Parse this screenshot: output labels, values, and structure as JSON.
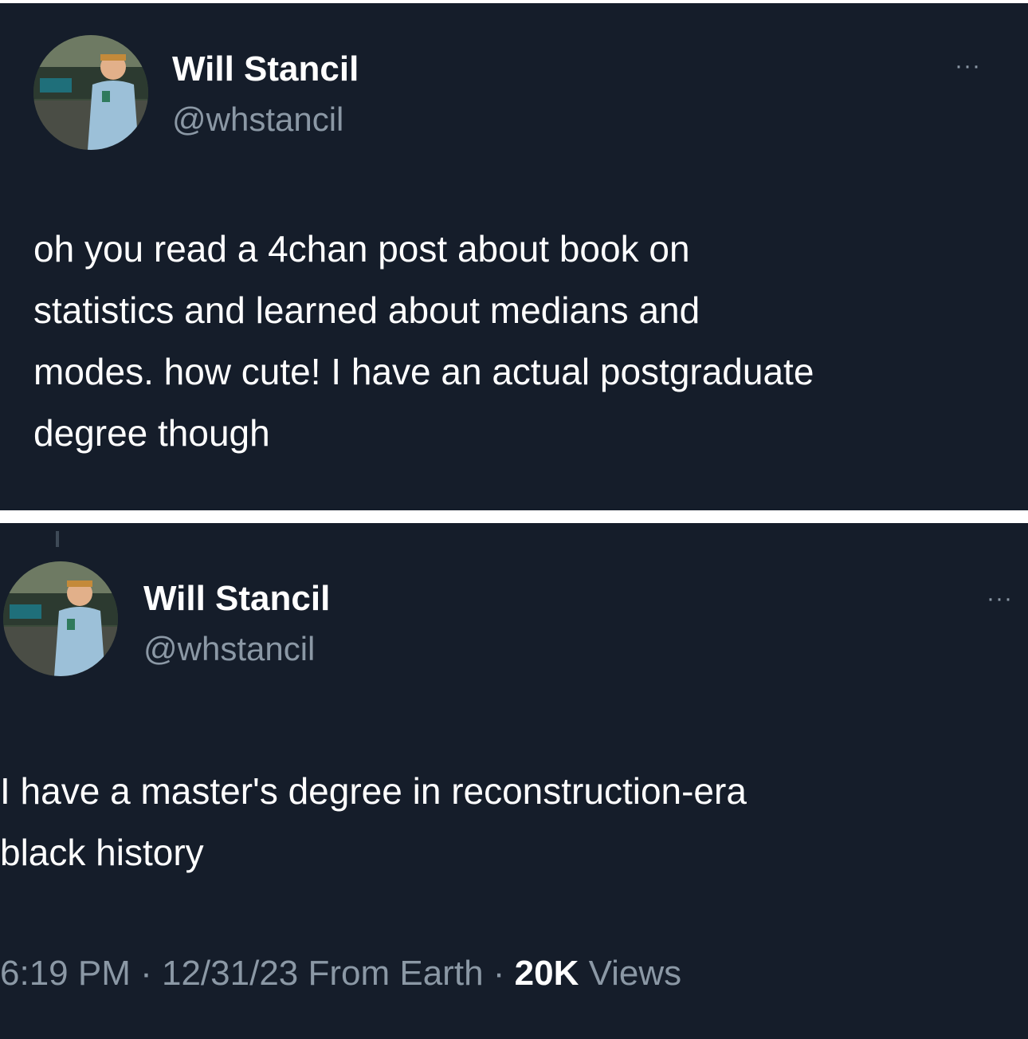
{
  "tweets": [
    {
      "display_name": "Will Stancil",
      "handle": "@whstancil",
      "more_label": "···",
      "text": "oh you read a 4chan post about book on\nstatistics and learned about medians and\nmodes. how cute! I have an actual postgraduate\ndegree though"
    },
    {
      "display_name": "Will Stancil",
      "handle": "@whstancil",
      "more_label": "···",
      "text": "I have a master's degree in reconstruction-era\nblack history",
      "meta": {
        "time": "6:19 PM",
        "sep1": " · ",
        "date": "12/31/23",
        "source": " From Earth",
        "sep2": " · ",
        "views_count": "20K",
        "views_label": " Views"
      }
    }
  ],
  "colors": {
    "background": "#151d2a",
    "divider": "#ffffff",
    "primary_text": "#ffffff",
    "secondary_text": "#8b98a5"
  }
}
